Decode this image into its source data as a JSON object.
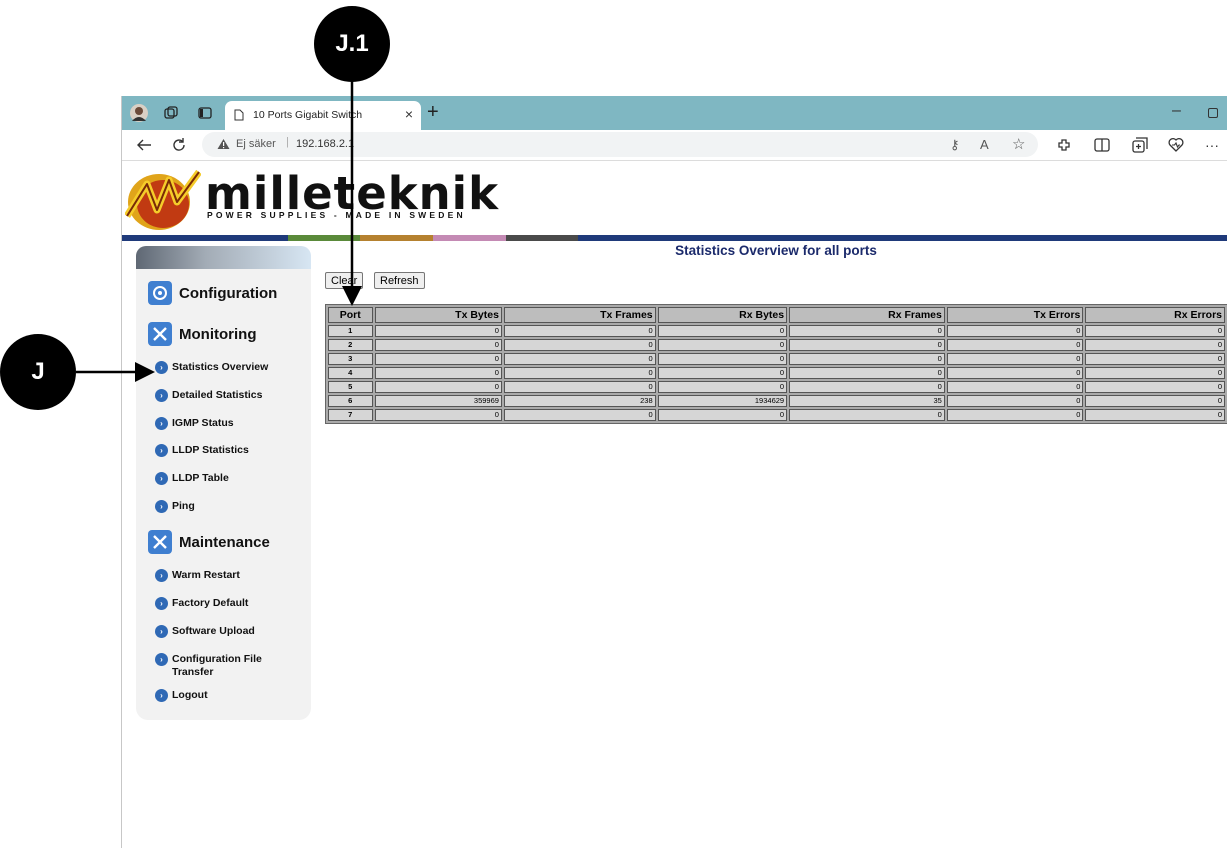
{
  "browser": {
    "tab_title": "10 Ports Gigabit Switch",
    "tab_close": "×",
    "new_tab": "+",
    "minimize": "–",
    "security_label": "Ej säker",
    "address": "192.168.2.1",
    "address_separator": "|",
    "icons": [
      "back-icon",
      "refresh-icon",
      "warning-icon",
      "key-icon",
      "read-aloud-icon",
      "favorite-icon",
      "extensions-icon",
      "split-screen-icon",
      "collections-icon",
      "performance-icon",
      "more-icon"
    ]
  },
  "logo": {
    "name": "milleteknik",
    "tagline": "POWER SUPPLIES - MADE IN SWEDEN"
  },
  "sidebar": {
    "sections": [
      {
        "label": "Configuration",
        "icon": "configuration-icon"
      },
      {
        "label": "Monitoring",
        "icon": "tools-icon"
      },
      {
        "label": "Maintenance",
        "icon": "tools-icon"
      }
    ],
    "monitoring_items": [
      "Statistics Overview",
      "Detailed Statistics",
      "IGMP Status",
      "LLDP Statistics",
      "LLDP Table",
      "Ping"
    ],
    "maintenance_items": [
      "Warm Restart",
      "Factory Default",
      "Software Upload",
      "Configuration File\nTransfer",
      "Logout"
    ]
  },
  "main": {
    "title": "Statistics Overview for all ports",
    "clear_label": "Clear",
    "refresh_label": "Refresh",
    "table": {
      "headers": [
        "Port",
        "Tx Bytes",
        "Tx Frames",
        "Rx Bytes",
        "Rx Frames",
        "Tx Errors",
        "Rx Errors"
      ],
      "rows": [
        [
          "1",
          "0",
          "0",
          "0",
          "0",
          "0",
          "0"
        ],
        [
          "2",
          "0",
          "0",
          "0",
          "0",
          "0",
          "0"
        ],
        [
          "3",
          "0",
          "0",
          "0",
          "0",
          "0",
          "0"
        ],
        [
          "4",
          "0",
          "0",
          "0",
          "0",
          "0",
          "0"
        ],
        [
          "5",
          "0",
          "0",
          "0",
          "0",
          "0",
          "0"
        ],
        [
          "6",
          "359969",
          "238",
          "1934629",
          "35",
          "0",
          "0"
        ],
        [
          "7",
          "0",
          "0",
          "0",
          "0",
          "0",
          "0"
        ]
      ]
    }
  },
  "callouts": {
    "j": "J",
    "j1": "J.1"
  },
  "colors": {
    "tabbar": "#7fb7c2",
    "stripe": [
      "#1f3a7a",
      "#5a8a3a",
      "#b5812f",
      "#c48ab4",
      "#4a4a4a",
      "#1f3a7a"
    ],
    "title": "#1b2a6b",
    "bullet": "#2f69b5"
  }
}
